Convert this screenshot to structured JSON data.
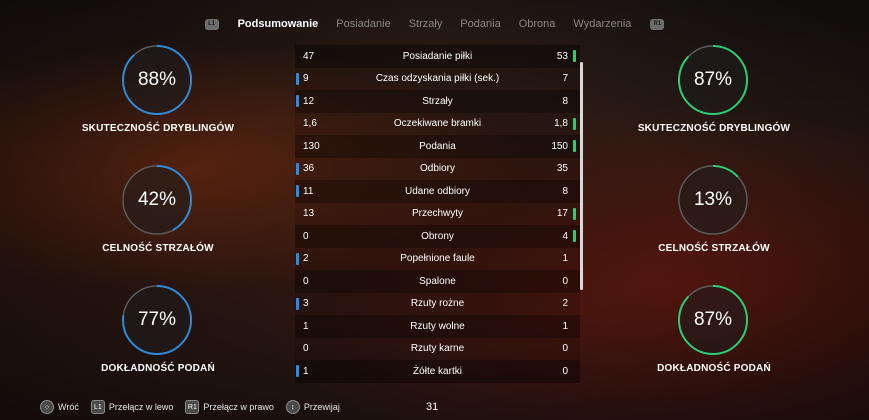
{
  "tabs": {
    "left_bumper": "L1",
    "right_bumper": "R1",
    "items": [
      "Podsumowanie",
      "Posiadanie",
      "Strzały",
      "Podania",
      "Obrona",
      "Wydarzenia"
    ],
    "active_index": 0
  },
  "gauges": {
    "left": [
      {
        "value": "88%",
        "fraction": 0.88,
        "title": "SKUTECZNOŚĆ DRYBLINGÓW"
      },
      {
        "value": "42%",
        "fraction": 0.42,
        "title": "CELNOŚĆ STRZAŁÓW"
      },
      {
        "value": "77%",
        "fraction": 0.77,
        "title": "DOKŁADNOŚĆ PODAŃ"
      }
    ],
    "right": [
      {
        "value": "87%",
        "fraction": 0.87,
        "title": "SKUTECZNOŚĆ DRYBLINGÓW"
      },
      {
        "value": "13%",
        "fraction": 0.13,
        "title": "CELNOŚĆ STRZAŁÓW"
      },
      {
        "value": "87%",
        "fraction": 0.87,
        "title": "DOKŁADNOŚĆ PODAŃ"
      }
    ],
    "colors": {
      "home": "#2f8ad9",
      "away": "#2ecc71",
      "track": "#5a5a5a"
    }
  },
  "stats": [
    {
      "home": "47",
      "label": "Posiadanie piłki",
      "away": "53",
      "leader": "away"
    },
    {
      "home": "9",
      "label": "Czas odzyskania piłki (sek.)",
      "away": "7",
      "leader": "home"
    },
    {
      "home": "12",
      "label": "Strzały",
      "away": "8",
      "leader": "home"
    },
    {
      "home": "1,6",
      "label": "Oczekiwane bramki",
      "away": "1,8",
      "leader": "away"
    },
    {
      "home": "130",
      "label": "Podania",
      "away": "150",
      "leader": "away"
    },
    {
      "home": "36",
      "label": "Odbiory",
      "away": "35",
      "leader": "home"
    },
    {
      "home": "11",
      "label": "Udane odbiory",
      "away": "8",
      "leader": "home"
    },
    {
      "home": "13",
      "label": "Przechwyty",
      "away": "17",
      "leader": "away"
    },
    {
      "home": "0",
      "label": "Obrony",
      "away": "4",
      "leader": "away"
    },
    {
      "home": "2",
      "label": "Popełnione faule",
      "away": "1",
      "leader": "home"
    },
    {
      "home": "0",
      "label": "Spalone",
      "away": "0",
      "leader": "none"
    },
    {
      "home": "3",
      "label": "Rzuty rożne",
      "away": "2",
      "leader": "home"
    },
    {
      "home": "1",
      "label": "Rzuty wolne",
      "away": "1",
      "leader": "none"
    },
    {
      "home": "0",
      "label": "Rzuty karne",
      "away": "0",
      "leader": "none"
    },
    {
      "home": "1",
      "label": "Żółte kartki",
      "away": "0",
      "leader": "home"
    }
  ],
  "footer": {
    "back": "Wróć",
    "prev": "Przełącz w lewo",
    "next": "Przełącz w prawo",
    "scroll": "Przewijaj",
    "clock": "31"
  }
}
